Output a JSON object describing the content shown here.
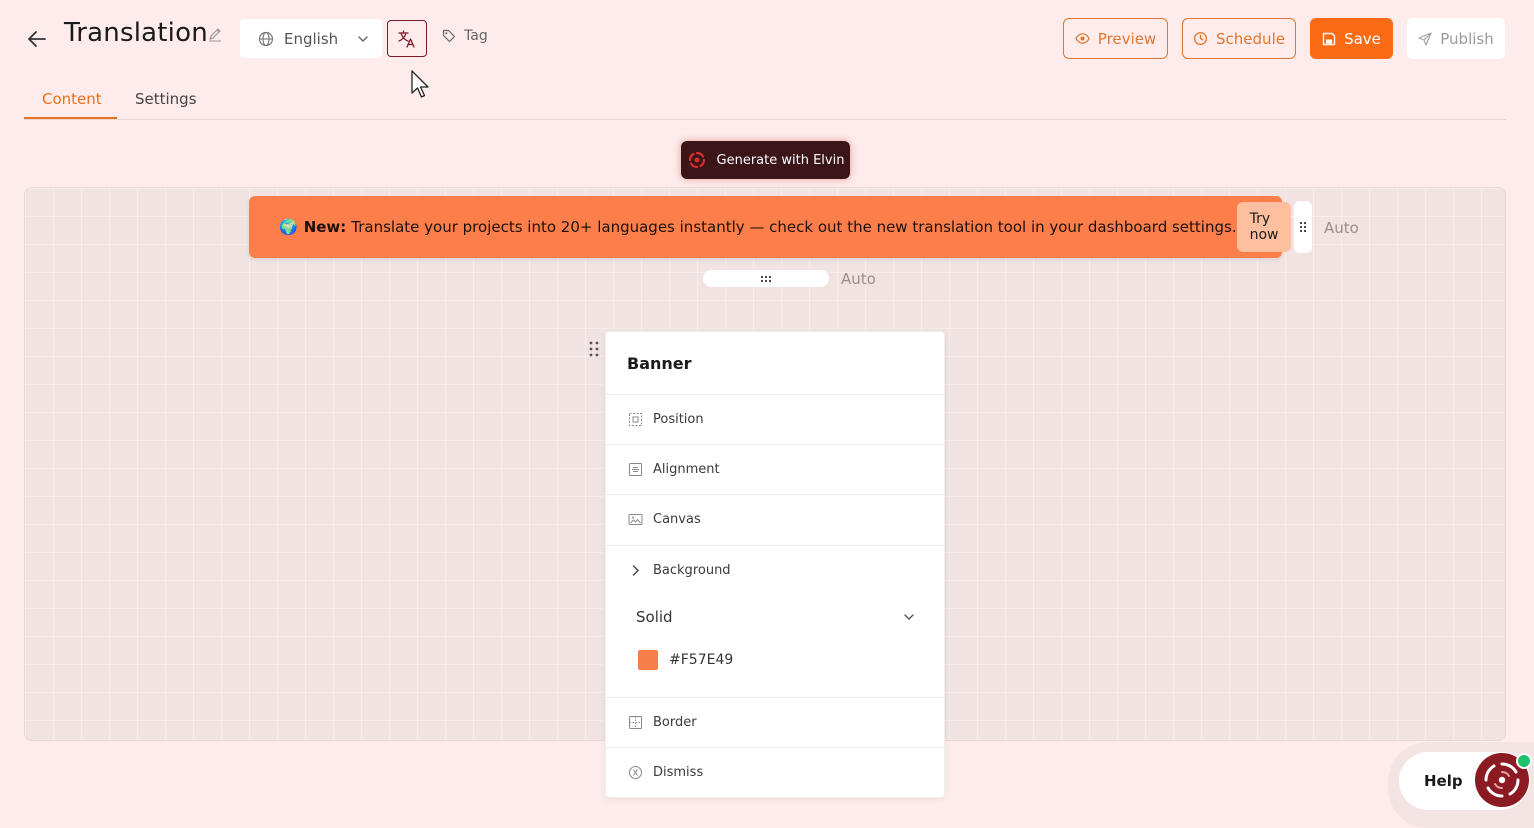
{
  "header": {
    "title": "Translation",
    "language": "English",
    "tag_label": "Tag",
    "preview_label": "Preview",
    "schedule_label": "Schedule",
    "save_label": "Save",
    "publish_label": "Publish"
  },
  "tabs": [
    {
      "label": "Content",
      "active": true
    },
    {
      "label": "Settings",
      "active": false
    }
  ],
  "generate_label": "Generate with Elvin",
  "announcement": {
    "emoji": "🌍",
    "new_label": "New:",
    "message": "Translate your projects into 20+ languages instantly — check out the new translation tool in your dashboard settings.",
    "cta_label": "Try now"
  },
  "auto_right": "Auto",
  "auto_bottom": "Auto",
  "panel": {
    "title": "Banner",
    "rows": {
      "position": "Position",
      "alignment": "Alignment",
      "canvas": "Canvas",
      "background": "Background",
      "border": "Border",
      "dismiss": "Dismiss"
    },
    "background_type": "Solid",
    "background_color": "#F57E49"
  },
  "help_label": "Help",
  "colors": {
    "accent": "#e5701f",
    "save": "#fb6a14",
    "banner": "#fc7f4b",
    "generate_bg": "#3b1517",
    "online": "#1ec26b"
  }
}
